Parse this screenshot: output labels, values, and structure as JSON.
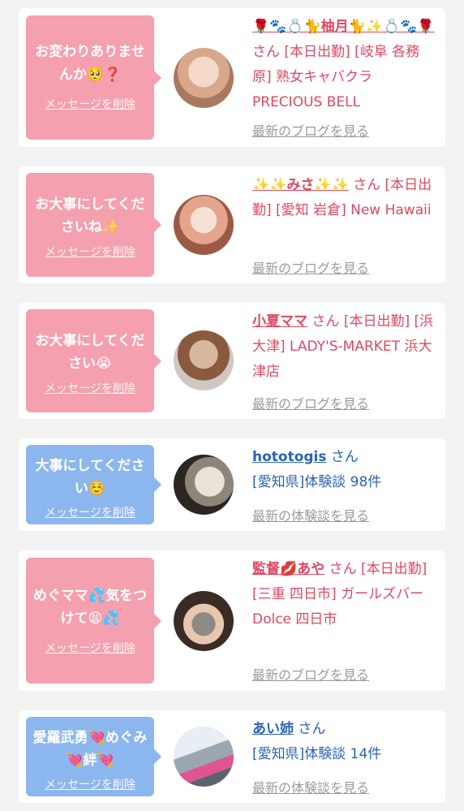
{
  "cards": [
    {
      "bubble_color": "pink",
      "message": "お変わりありませんか🥺❓",
      "delete_label": "メッセージを削除",
      "name": "🌹🐾💍🐈柚月🐈✨💍🐾🌹",
      "san": "さん",
      "detail": "[本日出勤] [岐阜 各務原] 熟女キャバクラ PRECIOUS BELL",
      "link": "最新のブログを見る"
    },
    {
      "bubble_color": "pink",
      "message": "お大事にしてくださいね✨",
      "delete_label": "メッセージを削除",
      "name": "✨✨みさ✨✨",
      "san": "さん",
      "detail": "[本日出勤] [愛知 岩倉] New Hawaii",
      "link": "最新のブログを見る"
    },
    {
      "bubble_color": "pink",
      "message": "お大事にしてください😭",
      "delete_label": "メッセージを削除",
      "name": "小夏ママ",
      "san": "さん",
      "detail": "[本日出勤] [浜大津] LADY'S-MARKET 浜大津店",
      "link": "最新のブログを見る"
    },
    {
      "bubble_color": "blue",
      "message": "大事にしてください☺️",
      "delete_label": "メッセージを削除",
      "name": "hototogis",
      "san": "さん",
      "detail": "[愛知県]体験談 98件",
      "link": "最新の体験談を見る"
    },
    {
      "bubble_color": "pink",
      "message": "めぐママ💦気をつけて😫💦",
      "delete_label": "メッセージを削除",
      "name": "監督💋あや",
      "san": "さん",
      "detail": "[本日出勤] [三重 四日市] ガールズバー Dolce 四日市",
      "link": "最新のブログを見る"
    },
    {
      "bubble_color": "blue",
      "message": "愛羅武勇💘めぐみ💘絆💘",
      "delete_label": "メッセージを削除",
      "name": "あい姉",
      "san": "さん",
      "detail": "[愛知県]体験談 14件",
      "link": "最新の体験談を見る"
    }
  ],
  "colors": {
    "pink_bubble": "#f5a0ae",
    "blue_bubble": "#8cb6ee",
    "pink_text": "#e0475f",
    "blue_text": "#2a64b4",
    "link_gray": "#9a9a9a"
  }
}
